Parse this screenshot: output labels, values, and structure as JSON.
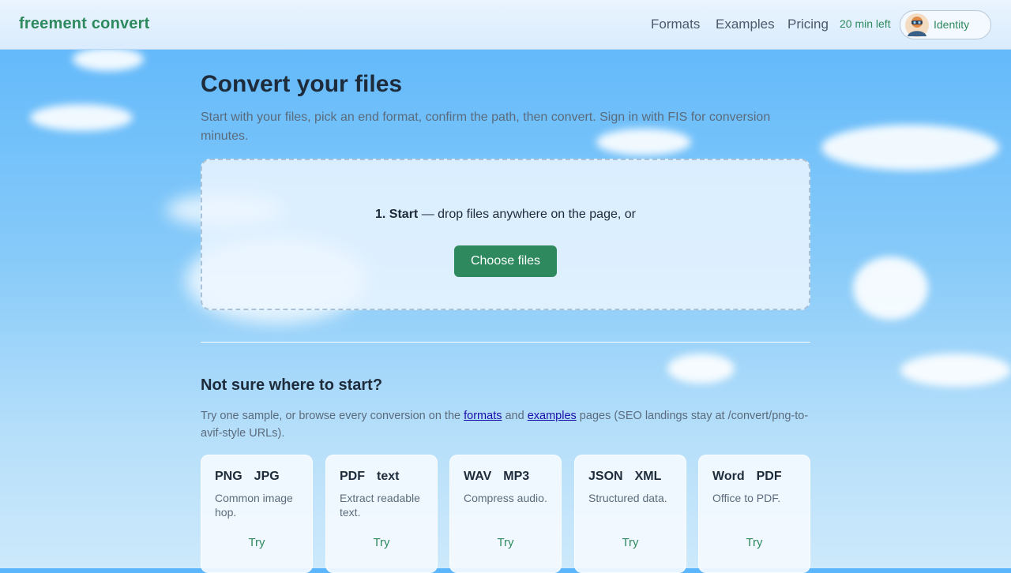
{
  "header": {
    "logo": "freement convert",
    "nav": [
      "Formats",
      "Examples",
      "Pricing"
    ],
    "minutes_left": "20 min left",
    "identity_label": "Identity"
  },
  "main": {
    "title": "Convert your files",
    "intro": "Start with your files, pick an end format, confirm the path, then convert. Sign in with FIS for conversion minutes.",
    "dropzone": {
      "step_label": "1. Start",
      "step_text": " — drop files anywhere on the page, or",
      "choose_button": "Choose files"
    },
    "samples": {
      "heading": "Not sure where to start?",
      "text_before": "Try one sample, or browse every conversion on the ",
      "link_formats": "formats",
      "text_and": " and ",
      "link_examples": "examples",
      "text_after": " pages (SEO landings stay at /convert/png-to-avif-style URLs).",
      "cards": [
        {
          "from": "PNG",
          "to": "JPG",
          "desc": "Common image hop.",
          "action": "Try"
        },
        {
          "from": "PDF",
          "to": "text",
          "desc": "Extract readable text.",
          "action": "Try"
        },
        {
          "from": "WAV",
          "to": "MP3",
          "desc": "Compress audio.",
          "action": "Try"
        },
        {
          "from": "JSON",
          "to": "XML",
          "desc": "Structured data.",
          "action": "Try"
        },
        {
          "from": "Word",
          "to": "PDF",
          "desc": "Office to PDF.",
          "action": "Try"
        }
      ]
    }
  },
  "colors": {
    "brand_green": "#2e8a5e",
    "sky_top": "#5cb6fb",
    "sky_bottom": "#cde9fb",
    "link_blue": "#1a0dab"
  },
  "icons": {
    "avatar": "avatar-icon"
  }
}
